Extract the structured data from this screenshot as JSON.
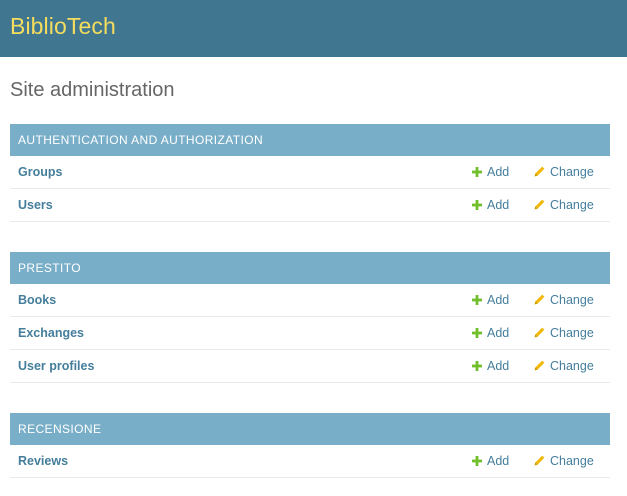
{
  "branding": {
    "title": "BiblioTech"
  },
  "page": {
    "title": "Site administration"
  },
  "colors": {
    "header_bg": "#417690",
    "brand_text": "#f5dd5d",
    "caption_bg": "#79aec8",
    "link": "#447e9b",
    "add_icon": "#70bf2b",
    "change_icon": "#efb80b"
  },
  "modules": [
    {
      "caption": "AUTHENTICATION AND AUTHORIZATION",
      "models": [
        {
          "name": "Groups",
          "add": "Add",
          "change": "Change"
        },
        {
          "name": "Users",
          "add": "Add",
          "change": "Change"
        }
      ]
    },
    {
      "caption": "PRESTITO",
      "models": [
        {
          "name": "Books",
          "add": "Add",
          "change": "Change"
        },
        {
          "name": "Exchanges",
          "add": "Add",
          "change": "Change"
        },
        {
          "name": "User profiles",
          "add": "Add",
          "change": "Change"
        }
      ]
    },
    {
      "caption": "RECENSIONE",
      "models": [
        {
          "name": "Reviews",
          "add": "Add",
          "change": "Change"
        }
      ]
    }
  ]
}
